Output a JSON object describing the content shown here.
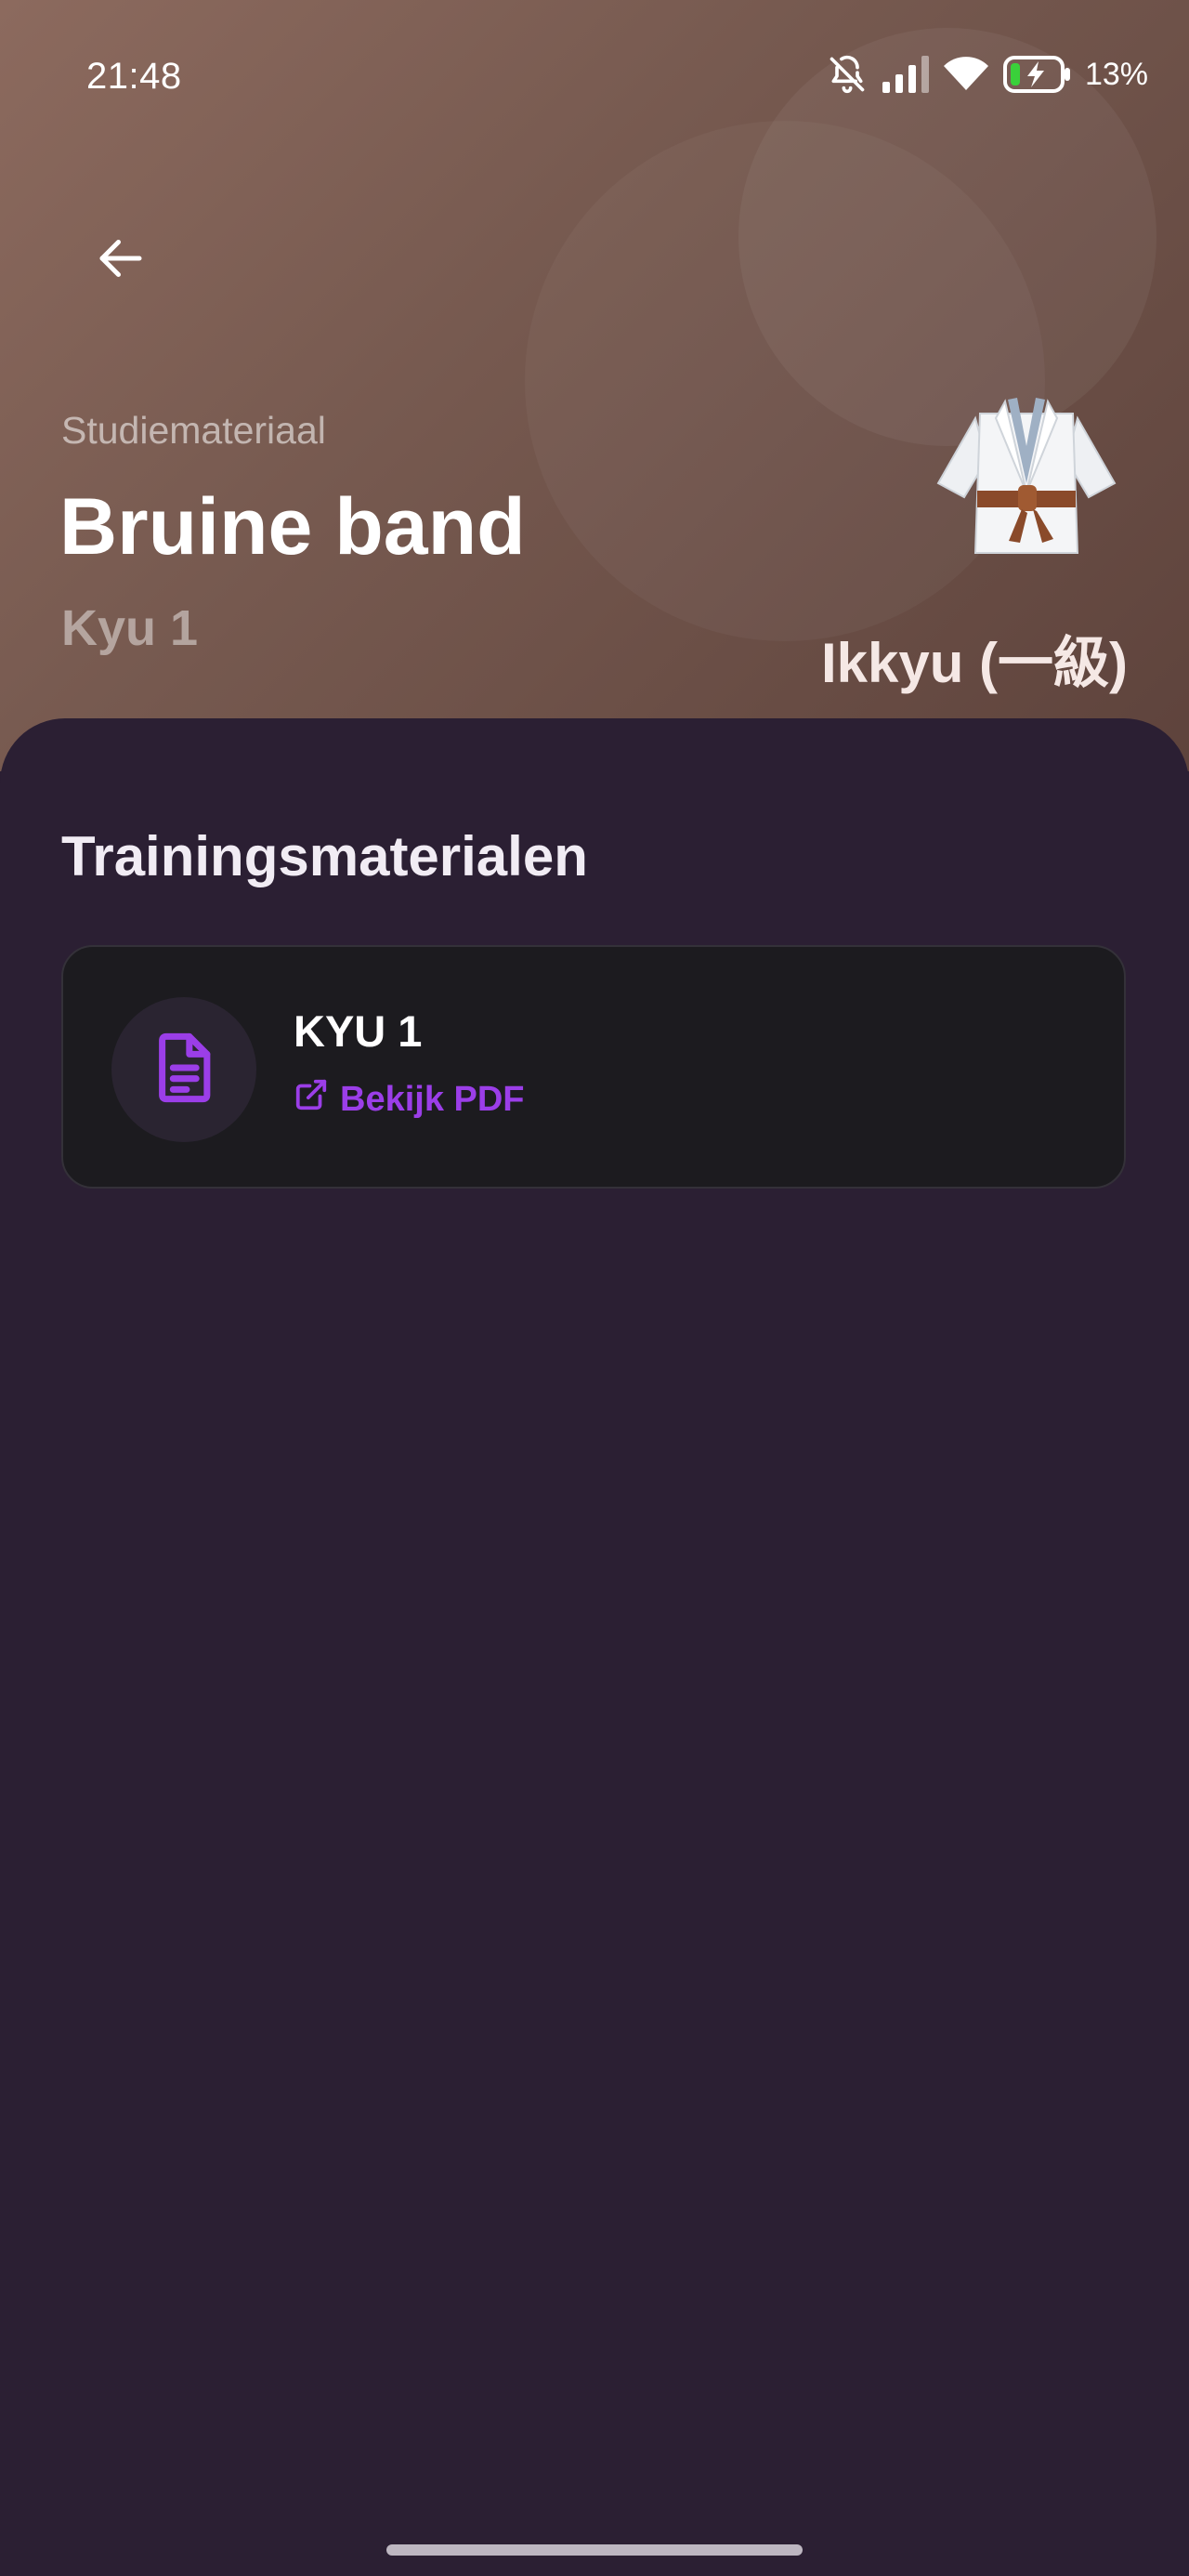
{
  "status_bar": {
    "time": "21:48",
    "battery_percent": "13%",
    "icons": [
      "bell-off-icon",
      "signal-icon",
      "wifi-icon",
      "battery-charging-icon"
    ]
  },
  "header": {
    "back_icon": "arrow-left-icon",
    "eyebrow": "Studiemateriaal",
    "title": "Bruine band",
    "subtitle": "Kyu 1",
    "japanese_name": "Ikkyu (一級)",
    "image_icon": "judo-gi-brown-belt-icon"
  },
  "content": {
    "section_title": "Trainingsmaterialen",
    "materials": [
      {
        "title": "KYU 1",
        "link_label": "Bekijk PDF",
        "icon": "document-icon",
        "link_icon": "external-link-icon"
      }
    ]
  },
  "colors": {
    "header_gradient_start": "#8c6a5e",
    "header_gradient_end": "#5e433c",
    "background": "#2b1f33",
    "card_background": "#1c1b1f",
    "accent": "#9b3ee8"
  }
}
